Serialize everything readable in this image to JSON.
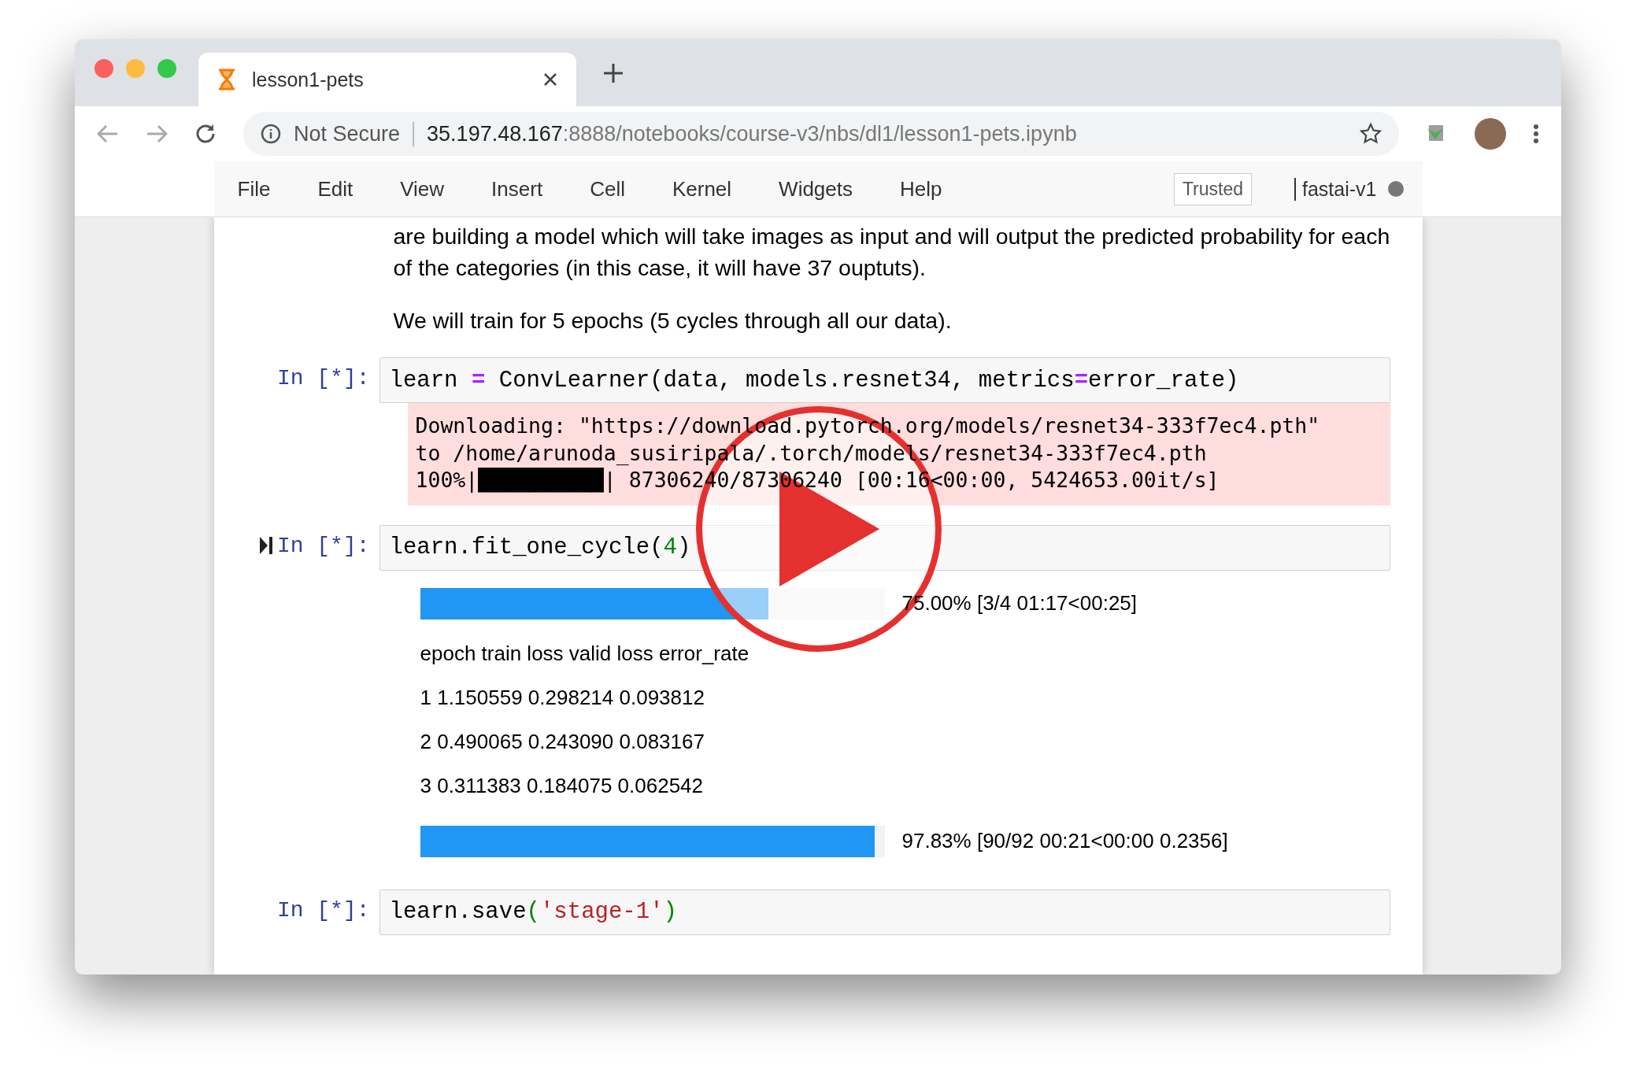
{
  "browser": {
    "tab": {
      "title": "lesson1-pets"
    },
    "address": {
      "security": "Not Secure",
      "host": "35.197.48.167",
      "path": ":8888/notebooks/course-v3/nbs/dl1/lesson1-pets.ipynb"
    }
  },
  "menu": {
    "items": [
      "File",
      "Edit",
      "View",
      "Insert",
      "Cell",
      "Kernel",
      "Widgets",
      "Help"
    ],
    "trusted": "Trusted",
    "kernel": "fastai-v1",
    "kernel_busy": true
  },
  "markdown": [
    "are building a model which will take images as input and will output the predicted probability for each of the categories (in this case, it will have 37 ouptuts).",
    "We will train for 5 epochs (5 cycles through all our data)."
  ],
  "cells": [
    {
      "prompt": "In [*]:",
      "selected": false,
      "code": [
        {
          "text": "learn ",
          "kind": "plain"
        },
        {
          "text": "=",
          "kind": "op"
        },
        {
          "text": " ConvLearner(data, models.resnet34, metrics",
          "kind": "plain"
        },
        {
          "text": "=",
          "kind": "op"
        },
        {
          "text": "error_rate)",
          "kind": "plain"
        }
      ],
      "outputs": [
        {
          "kind": "stderr",
          "lines": [
            "Downloading: \"https://download.pytorch.org/models/resnet34-333f7ec4.pth\" ",
            "to /home/arunoda_susiripala/.torch/models/resnet34-333f7ec4.pth",
            "100%|██████████| 87306240/87306240 [00:16<00:00, 5424653.00it/s]"
          ]
        }
      ]
    },
    {
      "prompt": "In [*]:",
      "selected": true,
      "code": [
        {
          "text": "learn.fit_one_cycle(",
          "kind": "plain"
        },
        {
          "text": "4",
          "kind": "number"
        },
        {
          "text": ")",
          "kind": "plain"
        }
      ],
      "outputs": [
        {
          "kind": "progress",
          "level": 0.75,
          "label": "75.00% [3/4 01:17<00:25]"
        },
        {
          "kind": "text",
          "text": "epoch train loss valid loss error_rate"
        },
        {
          "kind": "text",
          "text": "1 1.150559 0.298214 0.093812"
        },
        {
          "kind": "text",
          "text": "2 0.490065 0.243090 0.083167"
        },
        {
          "kind": "text",
          "text": "3 0.311383 0.184075 0.062542"
        },
        {
          "kind": "progress",
          "level": 0.9783,
          "label": "97.83% [90/92 00:21<00:00 0.2356]"
        }
      ]
    },
    {
      "prompt": "In [*]:",
      "selected": false,
      "code": [
        {
          "text": "learn.save",
          "kind": "plain"
        },
        {
          "text": "(",
          "kind": "paren"
        },
        {
          "text": "'stage-1'",
          "kind": "string"
        },
        {
          "text": ")",
          "kind": "paren"
        }
      ]
    }
  ]
}
